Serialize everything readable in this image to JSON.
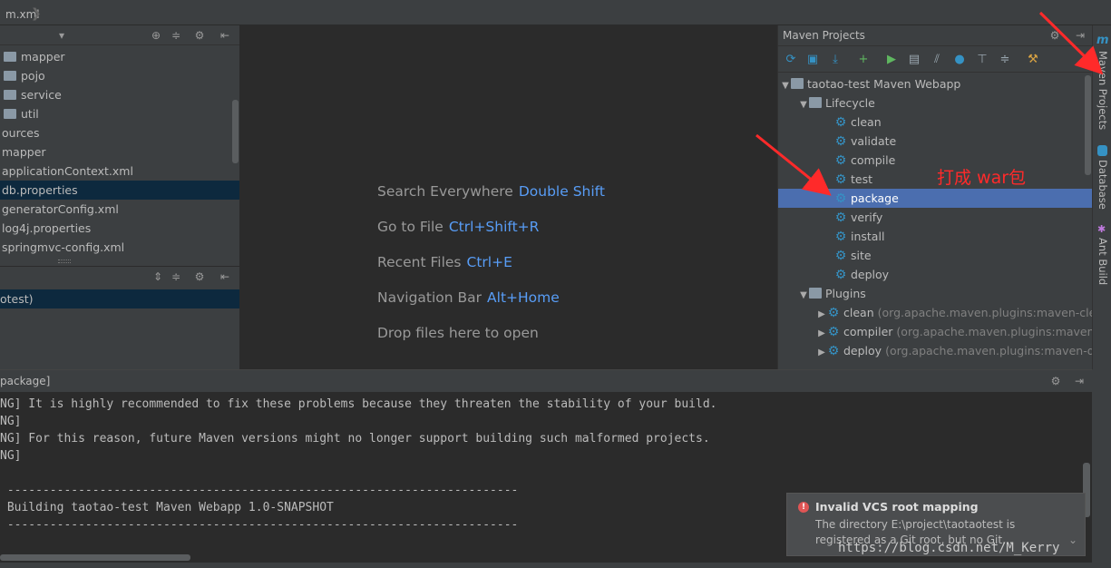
{
  "tab": {
    "file": "m.xml"
  },
  "project_tree": {
    "items": [
      {
        "label": "mapper",
        "kind": "folder",
        "selected": false
      },
      {
        "label": "pojo",
        "kind": "folder",
        "selected": false
      },
      {
        "label": "service",
        "kind": "folder",
        "selected": false
      },
      {
        "label": "util",
        "kind": "folder",
        "selected": false
      },
      {
        "label": "ources",
        "kind": "text",
        "selected": false
      },
      {
        "label": "mapper",
        "kind": "text",
        "selected": false
      },
      {
        "label": "applicationContext.xml",
        "kind": "text",
        "selected": false
      },
      {
        "label": "db.properties",
        "kind": "text",
        "selected": true
      },
      {
        "label": "generatorConfig.xml",
        "kind": "text",
        "selected": false
      },
      {
        "label": "log4j.properties",
        "kind": "text",
        "selected": false
      },
      {
        "label": "springmvc-config.xml",
        "kind": "text",
        "selected": false
      }
    ]
  },
  "structure": {
    "selected_label": "otest)"
  },
  "editor_hints": [
    {
      "text": "Search Everywhere",
      "key": "Double Shift"
    },
    {
      "text": "Go to File",
      "key": "Ctrl+Shift+R"
    },
    {
      "text": "Recent Files",
      "key": "Ctrl+E"
    },
    {
      "text": "Navigation Bar",
      "key": "Alt+Home"
    },
    {
      "text": "Drop files here to open",
      "key": ""
    }
  ],
  "maven": {
    "title": "Maven Projects",
    "project": "taotao-test Maven Webapp",
    "lifecycle_label": "Lifecycle",
    "lifecycle": [
      "clean",
      "validate",
      "compile",
      "test",
      "package",
      "verify",
      "install",
      "site",
      "deploy"
    ],
    "selected": "package",
    "plugins_label": "Plugins",
    "plugins": [
      {
        "name": "clean",
        "detail": "(org.apache.maven.plugins:maven-clean"
      },
      {
        "name": "compiler",
        "detail": "(org.apache.maven.plugins:maven-co"
      },
      {
        "name": "deploy",
        "detail": "(org.apache.maven.plugins:maven-dep"
      }
    ]
  },
  "annotation": {
    "text": "打成 war包",
    "color": "#ff2a2a"
  },
  "side_tabs": [
    "Maven Projects",
    "Database",
    "Ant Build"
  ],
  "console": {
    "header": "package]",
    "lines": [
      "NG] It is highly recommended to fix these problems because they threaten the stability of your build.",
      "NG]",
      "NG] For this reason, future Maven versions might no longer support building such malformed projects.",
      "NG]",
      "",
      " ------------------------------------------------------------------------",
      " Building taotao-test Maven Webapp 1.0-SNAPSHOT",
      " ------------------------------------------------------------------------"
    ]
  },
  "notification": {
    "title": "Invalid VCS root mapping",
    "line1": "The directory E:\\project\\taotaotest is",
    "line2": "registered as a Git root, but no Git..."
  },
  "watermark": "https://blog.csdn.net/M_Kerry",
  "colors": {
    "accent": "#589df6",
    "selection": "#4b6eaf",
    "panel": "#3c3f41",
    "editor": "#2b2b2b"
  }
}
